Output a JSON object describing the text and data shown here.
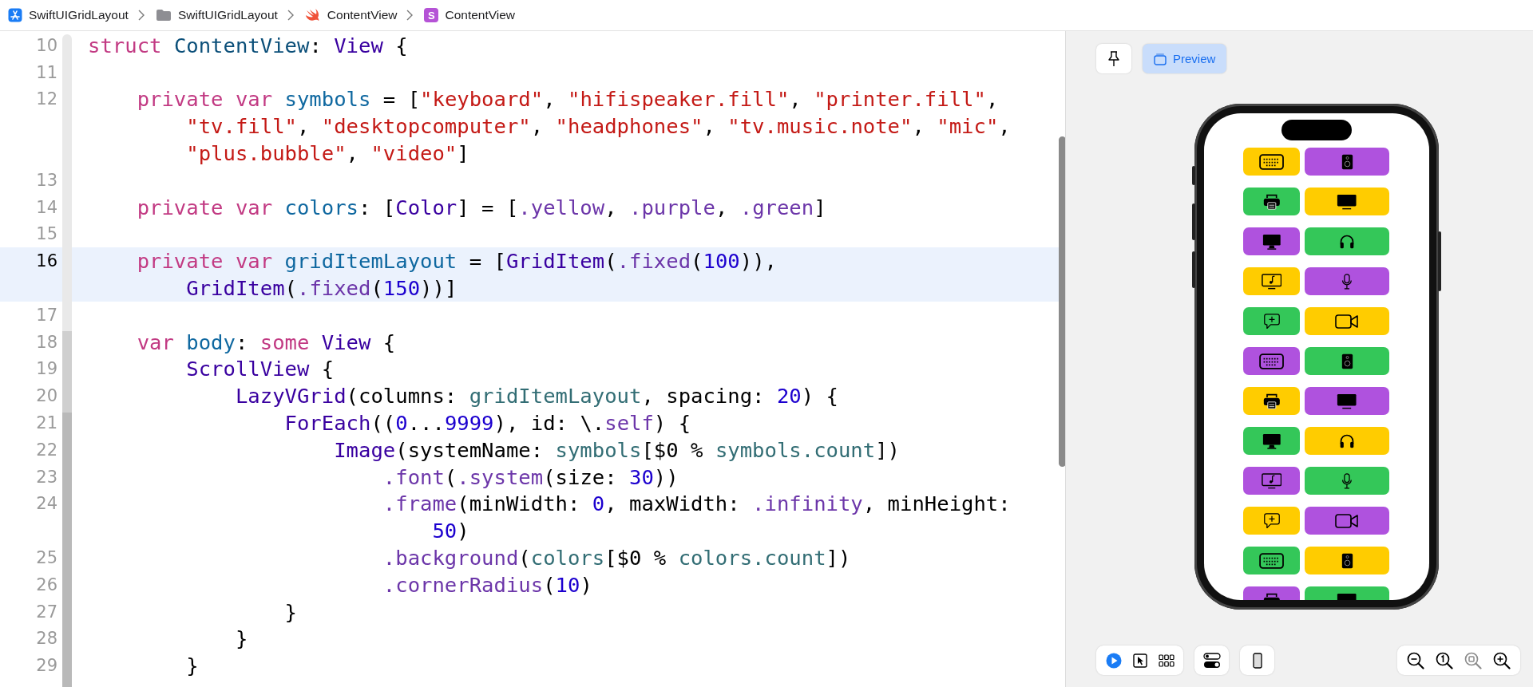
{
  "breadcrumb": [
    {
      "kind": "app",
      "label": "SwiftUIGridLayout"
    },
    {
      "kind": "folder",
      "label": "SwiftUIGridLayout"
    },
    {
      "kind": "swift",
      "label": "ContentView"
    },
    {
      "kind": "swiftui",
      "label": "ContentView",
      "icon_letter": "S"
    }
  ],
  "editor": {
    "lines": [
      {
        "number": "10",
        "selected": false,
        "rows": [
          {
            "segments": [
              {
                "kind": "keyword",
                "text": "struct "
              },
              {
                "kind": "type",
                "text": "ContentView"
              },
              {
                "kind": "plain",
                "text": ": "
              },
              {
                "kind": "system",
                "text": "View"
              },
              {
                "kind": "plain",
                "text": " {"
              }
            ]
          }
        ]
      },
      {
        "number": "11",
        "selected": false
      },
      {
        "number": "12",
        "selected": false,
        "rows": [
          {
            "segments": [
              {
                "kind": "keyword",
                "text": "    private var "
              },
              {
                "kind": "ident",
                "text": "symbols"
              },
              {
                "kind": "plain",
                "text": " = ["
              },
              {
                "kind": "string",
                "text": "\"keyboard\""
              },
              {
                "kind": "plain",
                "text": ", "
              },
              {
                "kind": "string",
                "text": "\"hifispeaker.fill\""
              },
              {
                "kind": "plain",
                "text": ", "
              },
              {
                "kind": "string",
                "text": "\"printer.fill\""
              },
              {
                "kind": "plain",
                "text": ","
              }
            ]
          },
          {
            "segments": [
              {
                "kind": "string",
                "text": "        \"tv.fill\""
              },
              {
                "kind": "plain",
                "text": ", "
              },
              {
                "kind": "string",
                "text": "\"desktopcomputer\""
              },
              {
                "kind": "plain",
                "text": ", "
              },
              {
                "kind": "string",
                "text": "\"headphones\""
              },
              {
                "kind": "plain",
                "text": ", "
              },
              {
                "kind": "string",
                "text": "\"tv.music.note\""
              },
              {
                "kind": "plain",
                "text": ", "
              },
              {
                "kind": "string",
                "text": "\"mic\""
              },
              {
                "kind": "plain",
                "text": ","
              }
            ]
          },
          {
            "segments": [
              {
                "kind": "string",
                "text": "        \"plus.bubble\""
              },
              {
                "kind": "plain",
                "text": ", "
              },
              {
                "kind": "string",
                "text": "\"video\""
              },
              {
                "kind": "plain",
                "text": "]"
              }
            ]
          }
        ]
      },
      {
        "number": "13",
        "selected": false
      },
      {
        "number": "14",
        "selected": false,
        "rows": [
          {
            "segments": [
              {
                "kind": "keyword",
                "text": "    private var "
              },
              {
                "kind": "ident",
                "text": "colors"
              },
              {
                "kind": "plain",
                "text": ": ["
              },
              {
                "kind": "system",
                "text": "Color"
              },
              {
                "kind": "plain",
                "text": "] = ["
              },
              {
                "kind": "member",
                "text": ".yellow"
              },
              {
                "kind": "plain",
                "text": ", "
              },
              {
                "kind": "member",
                "text": ".purple"
              },
              {
                "kind": "plain",
                "text": ", "
              },
              {
                "kind": "member",
                "text": ".green"
              },
              {
                "kind": "plain",
                "text": "]"
              }
            ]
          }
        ]
      },
      {
        "number": "15",
        "selected": false
      },
      {
        "number": "16",
        "selected": true,
        "rows": [
          {
            "segments": [
              {
                "kind": "keyword",
                "text": "    private var "
              },
              {
                "kind": "ident",
                "text": "gridItemLayout"
              },
              {
                "kind": "plain",
                "text": " = ["
              },
              {
                "kind": "system",
                "text": "GridItem"
              },
              {
                "kind": "plain",
                "text": "("
              },
              {
                "kind": "member",
                "text": ".fixed"
              },
              {
                "kind": "plain",
                "text": "("
              },
              {
                "kind": "number",
                "text": "100"
              },
              {
                "kind": "plain",
                "text": ")),"
              }
            ]
          },
          {
            "segments": [
              {
                "kind": "system",
                "text": "        GridItem"
              },
              {
                "kind": "plain",
                "text": "("
              },
              {
                "kind": "member",
                "text": ".fixed"
              },
              {
                "kind": "plain",
                "text": "("
              },
              {
                "kind": "number",
                "text": "150"
              },
              {
                "kind": "plain",
                "text": "))]"
              }
            ]
          }
        ]
      },
      {
        "number": "17",
        "selected": false
      },
      {
        "number": "18",
        "selected": false,
        "rows": [
          {
            "segments": [
              {
                "kind": "keyword",
                "text": "    var "
              },
              {
                "kind": "ident",
                "text": "body"
              },
              {
                "kind": "plain",
                "text": ": "
              },
              {
                "kind": "keyword",
                "text": "some "
              },
              {
                "kind": "system",
                "text": "View"
              },
              {
                "kind": "plain",
                "text": " {"
              }
            ]
          }
        ]
      },
      {
        "number": "19",
        "selected": false,
        "rows": [
          {
            "segments": [
              {
                "kind": "system",
                "text": "        ScrollView"
              },
              {
                "kind": "plain",
                "text": " {"
              }
            ]
          }
        ]
      },
      {
        "number": "20",
        "selected": false,
        "rows": [
          {
            "segments": [
              {
                "kind": "system",
                "text": "            LazyVGrid"
              },
              {
                "kind": "plain",
                "text": "(columns: "
              },
              {
                "kind": "project",
                "text": "gridItemLayout"
              },
              {
                "kind": "plain",
                "text": ", spacing: "
              },
              {
                "kind": "number",
                "text": "20"
              },
              {
                "kind": "plain",
                "text": ") {"
              }
            ]
          }
        ]
      },
      {
        "number": "21",
        "selected": false,
        "rows": [
          {
            "segments": [
              {
                "kind": "system",
                "text": "                ForEach"
              },
              {
                "kind": "plain",
                "text": "(("
              },
              {
                "kind": "number",
                "text": "0"
              },
              {
                "kind": "plain",
                "text": "..."
              },
              {
                "kind": "number",
                "text": "9999"
              },
              {
                "kind": "plain",
                "text": "), id: \\."
              },
              {
                "kind": "member",
                "text": "self"
              },
              {
                "kind": "plain",
                "text": ") {"
              }
            ]
          }
        ]
      },
      {
        "number": "22",
        "selected": false,
        "rows": [
          {
            "segments": [
              {
                "kind": "system",
                "text": "                    Image"
              },
              {
                "kind": "plain",
                "text": "(systemName: "
              },
              {
                "kind": "project",
                "text": "symbols"
              },
              {
                "kind": "plain",
                "text": "[$0 % "
              },
              {
                "kind": "project",
                "text": "symbols.count"
              },
              {
                "kind": "plain",
                "text": "])"
              }
            ]
          }
        ]
      },
      {
        "number": "23",
        "selected": false,
        "rows": [
          {
            "segments": [
              {
                "kind": "member",
                "text": "                        .font"
              },
              {
                "kind": "plain",
                "text": "("
              },
              {
                "kind": "member",
                "text": ".system"
              },
              {
                "kind": "plain",
                "text": "(size: "
              },
              {
                "kind": "number",
                "text": "30"
              },
              {
                "kind": "plain",
                "text": "))"
              }
            ]
          }
        ]
      },
      {
        "number": "24",
        "selected": false,
        "rows": [
          {
            "segments": [
              {
                "kind": "member",
                "text": "                        .frame"
              },
              {
                "kind": "plain",
                "text": "(minWidth: "
              },
              {
                "kind": "number",
                "text": "0"
              },
              {
                "kind": "plain",
                "text": ", maxWidth: "
              },
              {
                "kind": "member",
                "text": ".infinity"
              },
              {
                "kind": "plain",
                "text": ", minHeight:"
              }
            ]
          },
          {
            "segments": [
              {
                "kind": "number",
                "text": "                            50"
              },
              {
                "kind": "plain",
                "text": ")"
              }
            ]
          }
        ]
      },
      {
        "number": "25",
        "selected": false,
        "rows": [
          {
            "segments": [
              {
                "kind": "member",
                "text": "                        .background"
              },
              {
                "kind": "plain",
                "text": "("
              },
              {
                "kind": "project",
                "text": "colors"
              },
              {
                "kind": "plain",
                "text": "[$0 % "
              },
              {
                "kind": "project",
                "text": "colors.count"
              },
              {
                "kind": "plain",
                "text": "])"
              }
            ]
          }
        ]
      },
      {
        "number": "26",
        "selected": false,
        "rows": [
          {
            "segments": [
              {
                "kind": "member",
                "text": "                        .cornerRadius"
              },
              {
                "kind": "plain",
                "text": "("
              },
              {
                "kind": "number",
                "text": "10"
              },
              {
                "kind": "plain",
                "text": ")"
              }
            ]
          }
        ]
      },
      {
        "number": "27",
        "selected": false,
        "rows": [
          {
            "segments": [
              {
                "kind": "plain",
                "text": "                }"
              }
            ]
          }
        ]
      },
      {
        "number": "28",
        "selected": false,
        "rows": [
          {
            "segments": [
              {
                "kind": "plain",
                "text": "            }"
              }
            ]
          }
        ]
      },
      {
        "number": "29",
        "selected": false,
        "rows": [
          {
            "segments": [
              {
                "kind": "plain",
                "text": "        }"
              }
            ]
          }
        ]
      }
    ]
  },
  "preview": {
    "pin_button": {
      "selected": false
    },
    "preview_button": {
      "label": "Preview",
      "selected": true
    },
    "cells": [
      {
        "kind": "keyboard",
        "color": "#ffcc00"
      },
      {
        "kind": "speaker",
        "color": "#af52de"
      },
      {
        "kind": "printer",
        "color": "#34c759"
      },
      {
        "kind": "tv",
        "color": "#ffcc00"
      },
      {
        "kind": "desktop",
        "color": "#af52de"
      },
      {
        "kind": "headphones",
        "color": "#34c759"
      },
      {
        "kind": "tvmusic",
        "color": "#ffcc00"
      },
      {
        "kind": "mic",
        "color": "#af52de"
      },
      {
        "kind": "bubble",
        "color": "#34c759"
      },
      {
        "kind": "video",
        "color": "#ffcc00"
      },
      {
        "kind": "keyboard",
        "color": "#af52de"
      },
      {
        "kind": "speaker",
        "color": "#34c759"
      },
      {
        "kind": "printer",
        "color": "#ffcc00"
      },
      {
        "kind": "tv",
        "color": "#af52de"
      },
      {
        "kind": "desktop",
        "color": "#34c759"
      },
      {
        "kind": "headphones",
        "color": "#ffcc00"
      },
      {
        "kind": "tvmusic",
        "color": "#af52de"
      },
      {
        "kind": "mic",
        "color": "#34c759"
      },
      {
        "kind": "bubble",
        "color": "#ffcc00"
      },
      {
        "kind": "video",
        "color": "#af52de"
      },
      {
        "kind": "keyboard",
        "color": "#34c759"
      },
      {
        "kind": "speaker",
        "color": "#ffcc00"
      },
      {
        "kind": "printer",
        "color": "#af52de"
      },
      {
        "kind": "tv",
        "color": "#34c759"
      }
    ],
    "modes": [
      {
        "kind": "live",
        "selected": true
      },
      {
        "kind": "select",
        "selected": false
      }
    ],
    "zoom": [
      {
        "kind": "out",
        "disabled": false
      },
      {
        "kind": "actual",
        "disabled": false
      },
      {
        "kind": "fit",
        "disabled": true
      },
      {
        "kind": "in",
        "disabled": false
      }
    ]
  }
}
